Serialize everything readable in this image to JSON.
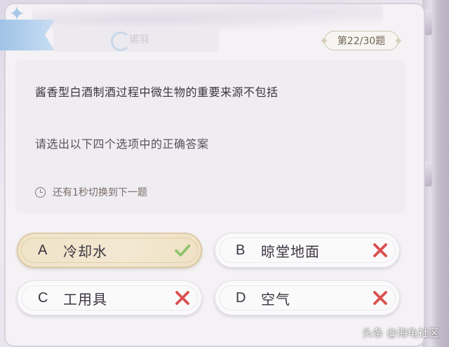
{
  "header": {
    "faded_tab_text": "诺羽",
    "counter": "第22/30题"
  },
  "question": {
    "text": "酱香型白酒制酒过程中微生物的重要来源不包括",
    "instruction": "请选出以下四个选项中的正确答案",
    "timer_text": "还有1秒切换到下一题"
  },
  "options": [
    {
      "letter": "A",
      "label": "冷却水",
      "status": "correct",
      "icon": "check-icon"
    },
    {
      "letter": "B",
      "label": "晾堂地面",
      "status": "wrong",
      "icon": "cross-icon"
    },
    {
      "letter": "C",
      "label": "工用具",
      "status": "wrong",
      "icon": "cross-icon"
    },
    {
      "letter": "D",
      "label": "空气",
      "status": "wrong",
      "icon": "cross-icon"
    }
  ],
  "colors": {
    "correct_mark": "#8cc46a",
    "wrong_mark": "#d9514f",
    "correct_bg": "#efe3c8"
  },
  "watermark": "头条 @海龟社区"
}
